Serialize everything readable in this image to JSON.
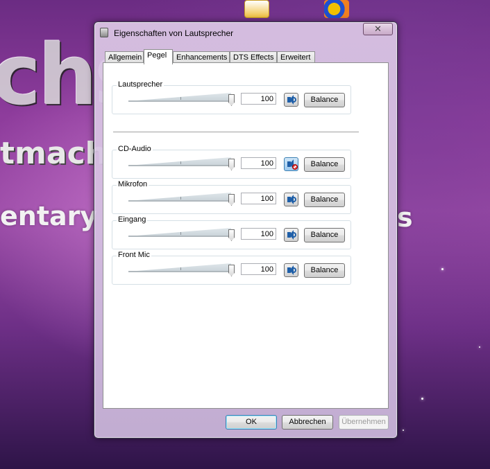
{
  "desktop": {
    "icons": [
      {
        "label": ""
      },
      {
        "label": ""
      }
    ]
  },
  "window": {
    "title": "Eigenschaften von Lautsprecher",
    "close_label": "✕"
  },
  "tabs": [
    {
      "label": "Allgemein"
    },
    {
      "label": "Pegel"
    },
    {
      "label": "Enhancements"
    },
    {
      "label": "DTS Effects"
    },
    {
      "label": "Erweitert"
    }
  ],
  "active_tab": "Pegel",
  "channels": [
    {
      "name": "Lautsprecher",
      "value": "100",
      "level": 1.0,
      "muted": false,
      "balance_label": "Balance"
    },
    {
      "name": "CD-Audio",
      "value": "100",
      "level": 1.0,
      "muted": true,
      "balance_label": "Balance"
    },
    {
      "name": "Mikrofon",
      "value": "100",
      "level": 1.0,
      "muted": false,
      "balance_label": "Balance"
    },
    {
      "name": "Eingang",
      "value": "100",
      "level": 1.0,
      "muted": false,
      "balance_label": "Balance"
    },
    {
      "name": "Front Mic",
      "value": "100",
      "level": 1.0,
      "muted": false,
      "balance_label": "Balance"
    }
  ],
  "footer": {
    "ok_label": "OK",
    "cancel_label": "Abbrechen",
    "apply_label": "Übernehmen"
  },
  "icon_names": {
    "speaker": "speaker-icon",
    "muted_speaker": "speaker-muted-icon",
    "window": "speaker-properties-icon"
  }
}
